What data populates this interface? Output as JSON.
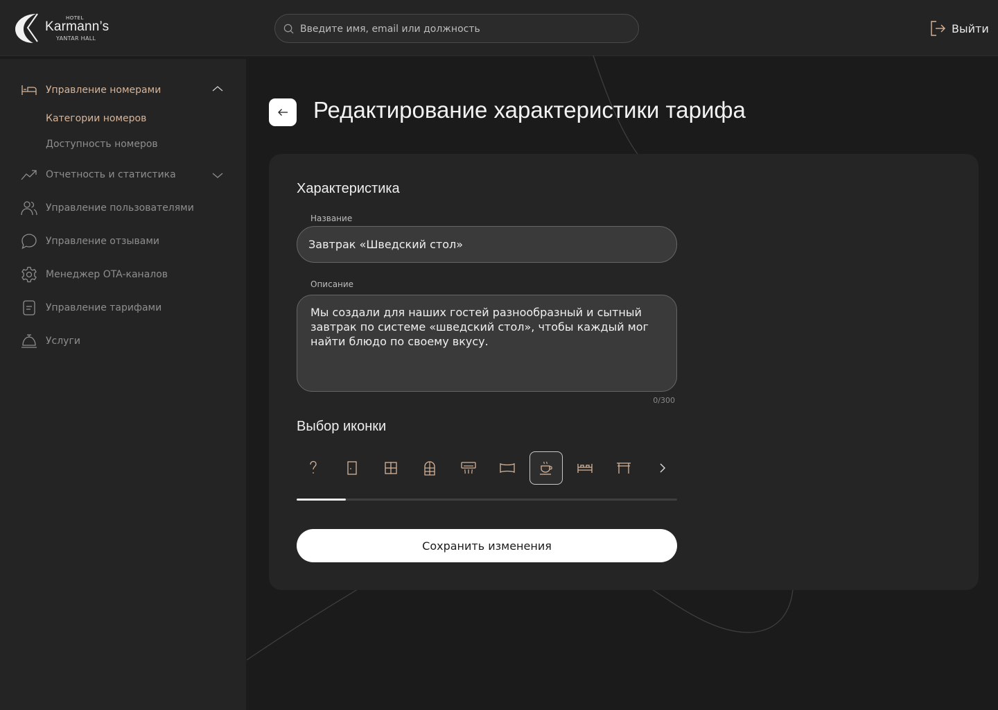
{
  "logo": {
    "hotel": "HOTEL",
    "name": "Karmann’s",
    "subtitle": "YANTAR HALL"
  },
  "search": {
    "placeholder": "Введите имя, email или должность",
    "value": ""
  },
  "header": {
    "logout_label": "Выйти"
  },
  "sidebar": {
    "items": [
      {
        "label": "Управление номерами",
        "icon": "bed-icon",
        "expanded": true,
        "children": [
          {
            "label": "Категории номеров",
            "active": true
          },
          {
            "label": "Доступность номеров",
            "active": false
          }
        ]
      },
      {
        "label": "Отчетность и статистика",
        "icon": "trend-up-icon",
        "expanded": false
      },
      {
        "label": "Управление пользователями",
        "icon": "users-icon"
      },
      {
        "label": "Управление отзывами",
        "icon": "chat-bubble-icon"
      },
      {
        "label": "Менеджер OTA-каналов",
        "icon": "gear-icon"
      },
      {
        "label": "Управление тарифами",
        "icon": "document-icon"
      },
      {
        "label": "Услуги",
        "icon": "service-bell-icon"
      }
    ]
  },
  "page": {
    "title": "Редактирование характеристики тарифа"
  },
  "form": {
    "section_title": "Характеристика",
    "name_label": "Название",
    "name_value": "Завтрак «Шведский стол»",
    "description_label": "Описание",
    "description_value": "Мы создали для наших гостей разнообразный и сытный завтрак по системе «шведский стол», чтобы каждый мог найти блюдо по своему вкусу.",
    "counter": "0/300",
    "icon_section_title": "Выбор иконки",
    "icons": [
      "question-icon",
      "door-icon",
      "window-icon",
      "arched-window-icon",
      "air-conditioner-icon",
      "rug-icon",
      "coffee-cup-icon",
      "bed-icon",
      "table-icon"
    ],
    "selected_icon": "coffee-cup-icon",
    "scroll_progress": 0.13,
    "save_label": "Сохранить изменения"
  },
  "colors": {
    "accent": "#d7b59a",
    "background": "#1b1b1b",
    "panel": "#252525"
  }
}
